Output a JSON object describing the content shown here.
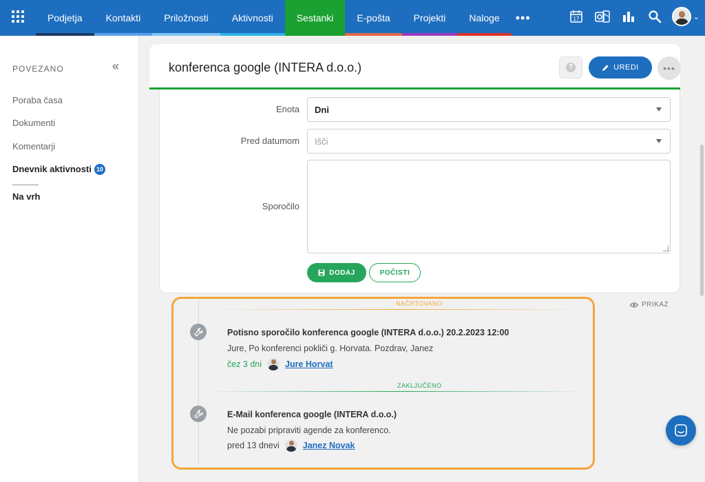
{
  "nav": {
    "items": [
      {
        "label": "Podjetja",
        "bar": "#1b3a66"
      },
      {
        "label": "Kontakti",
        "bar": "#5aa0e8"
      },
      {
        "label": "Priložnosti",
        "bar": "#7cc4f2"
      },
      {
        "label": "Aktivnosti",
        "bar": "#2bb3e6"
      },
      {
        "label": "Sestanki",
        "bar": "#1aa132"
      },
      {
        "label": "E-pošta",
        "bar": "#e06a4a"
      },
      {
        "label": "Projekti",
        "bar": "#9b3bc1"
      },
      {
        "label": "Naloge",
        "bar": "#d9342b"
      }
    ],
    "more": "•••",
    "calendar_day": "17",
    "active_index": 4
  },
  "sidebar": {
    "header": "POVEZANO",
    "items": [
      {
        "label": "Poraba časa"
      },
      {
        "label": "Dokumenti"
      },
      {
        "label": "Komentarji"
      },
      {
        "label": "Dnevnik aktivnosti",
        "badge": "10"
      }
    ],
    "to_top": "Na vrh"
  },
  "header": {
    "title": "konferenca google (INTERA d.o.o.)",
    "edit_label": "UREDI"
  },
  "form": {
    "unit_label": "Enota",
    "unit_value": "Dni",
    "before_label": "Pred datumom",
    "before_placeholder": "Išči",
    "message_label": "Sporočilo",
    "add_label": "DODAJ",
    "clear_label": "POČISTI"
  },
  "timeline": {
    "view_label": "PRIKAZ",
    "planned_label": "NAČRTOVANO",
    "done_label": "ZAKLJUČENO",
    "entries": [
      {
        "title": "Potisno sporočilo konferenca google (INTERA d.o.o.) 20.2.2023 12:00",
        "body": "Jure, Po konferenci pokliči g. Horvata. Pozdrav, Janez",
        "when": "čez 3 dni",
        "person": "Jure Horvat"
      },
      {
        "title": "E-Mail konferenca google (INTERA d.o.o.)",
        "body": "Ne pozabi pripraviti agende za konferenco.",
        "when": "pred 13 dnevi",
        "person": "Janez Novak"
      }
    ]
  },
  "colors": {
    "primary": "#1e6ec0",
    "active_green": "#1aa132",
    "highlight_orange": "#f4a53a"
  }
}
